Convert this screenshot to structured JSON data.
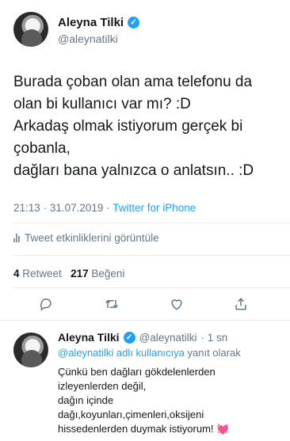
{
  "tweet": {
    "author": {
      "name": "Aleyna Tilki",
      "handle": "@aleynatilki"
    },
    "text_lines": [
      "Burada çoban olan ama telefonu da",
      "olan bi kullanıcı var mı? :D",
      "Arkadaş olmak istiyorum gerçek bi",
      "çobanla,",
      "dağları bana yalnızca o anlatsın.. :D"
    ],
    "time": "21:13",
    "dot": "·",
    "date": "31.07.2019",
    "source": "Twitter for iPhone",
    "activity_label": "Tweet etkinliklerini görüntüle",
    "retweets": "4",
    "retweets_label": "Retweet",
    "likes": "217",
    "likes_label": "Beğeni"
  },
  "reply": {
    "author": {
      "name": "Aleyna Tilki",
      "handle": "@aleynatilki",
      "age": "· 1 sn"
    },
    "reply_to_mention": "@aleynatilki adlı kullanıcıya",
    "reply_to_suffix": "yanıt olarak",
    "text_lines": [
      "Çünkü ben dağları gökdelenlerden",
      "izleyenlerden değil,",
      "dağın içinde",
      "dağı,koyunları,çimenleri,oksijeni",
      "hissedenlerden duymak istiyorum!"
    ],
    "emoji": "💓"
  },
  "icons": {
    "verified": "verified-badge-icon",
    "activity": "analytics-bars-icon",
    "reply": "reply-icon",
    "retweet": "retweet-icon",
    "like": "like-icon",
    "share": "share-icon"
  },
  "colors": {
    "accent": "#1da1f2",
    "muted": "#657786",
    "text": "#14171a",
    "divider": "#e6ecf0"
  }
}
